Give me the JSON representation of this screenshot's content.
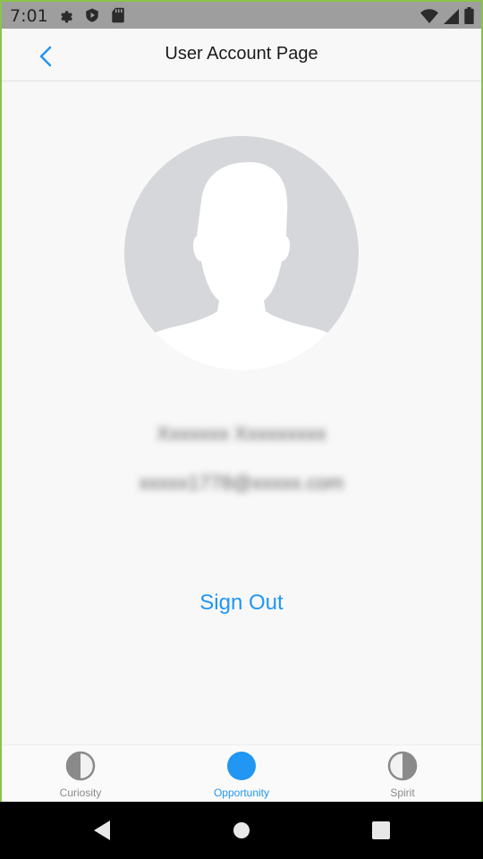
{
  "status_bar": {
    "time": "7:01",
    "left_icons": [
      "settings-gear-icon",
      "shield-icon",
      "sd-card-icon"
    ],
    "right_icons": [
      "wifi-icon",
      "signal-icon",
      "battery-icon"
    ],
    "background": "#9e9e9e"
  },
  "header": {
    "title": "User Account Page",
    "back_icon": "chevron-left-icon",
    "accent": "#2196f3"
  },
  "profile": {
    "avatar_icon": "person-silhouette-icon",
    "name": "Xxxxxxx Xxxxxxxxx",
    "email": "xxxxx1778@xxxxx.com",
    "name_obscured": true,
    "email_obscured": true
  },
  "actions": {
    "sign_out_label": "Sign Out"
  },
  "bottom_nav": {
    "items": [
      {
        "label": "Curiosity",
        "icon": "half-circle-icon",
        "active": false
      },
      {
        "label": "Opportunity",
        "icon": "filled-circle-icon",
        "active": true
      },
      {
        "label": "Spirit",
        "icon": "half-circle-icon",
        "active": false
      }
    ],
    "active_color": "#2196f3",
    "inactive_color": "#8a8a8a"
  },
  "system_nav": {
    "buttons": [
      "back-triangle-icon",
      "home-circle-icon",
      "recents-square-icon"
    ]
  },
  "frame_color": "#8bc34a"
}
